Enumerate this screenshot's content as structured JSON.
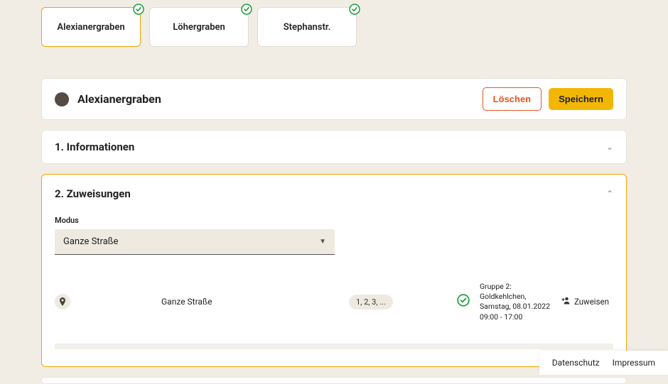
{
  "tabs": [
    {
      "label": "Alexianergraben",
      "active": true
    },
    {
      "label": "Löhergraben",
      "active": false
    },
    {
      "label": "Stephanstr.",
      "active": false
    }
  ],
  "header": {
    "avatar_letter": "",
    "title": "Alexianergraben",
    "delete_label": "Löschen",
    "save_label": "Speichern"
  },
  "section1": {
    "title": "1. Informationen"
  },
  "section2": {
    "title": "2. Zuweisungen",
    "mode_label": "Modus",
    "mode_value": "Ganze Straße",
    "row": {
      "label": "Ganze Straße",
      "chip": "1, 2, 3, ...",
      "details_line1": "Gruppe 2:",
      "details_line2": "Goldkehlchen,",
      "details_line3": "Samstag, 08.01.2022",
      "details_line4": "09:00 - 17:00",
      "assign_label": "Zuweisen"
    }
  },
  "footer": {
    "privacy": "Datenschutz",
    "imprint": "Impressum"
  }
}
